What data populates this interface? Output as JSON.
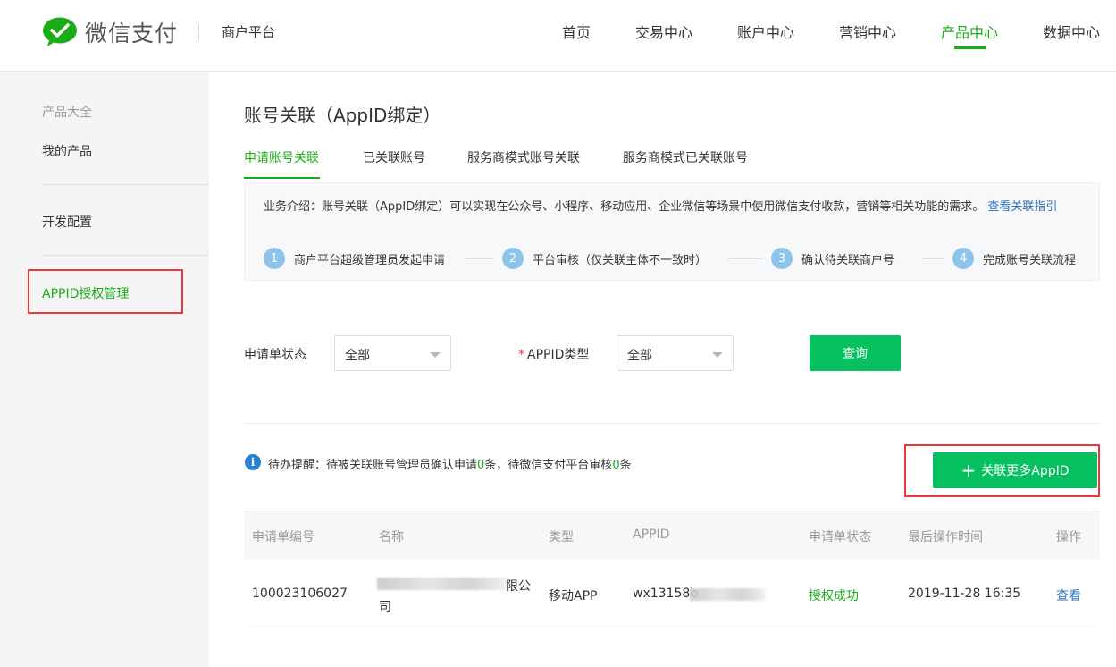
{
  "header": {
    "brand": "微信支付",
    "platform": "商户平台",
    "nav": [
      {
        "label": "首页",
        "active": false
      },
      {
        "label": "交易中心",
        "active": false
      },
      {
        "label": "账户中心",
        "active": false
      },
      {
        "label": "营销中心",
        "active": false
      },
      {
        "label": "产品中心",
        "active": true
      },
      {
        "label": "数据中心",
        "active": false
      }
    ]
  },
  "sidebar": {
    "group_title": "产品大全",
    "items": [
      "我的产品",
      "开发配置",
      "APPID授权管理"
    ],
    "active": "APPID授权管理"
  },
  "page": {
    "title": "账号关联（AppID绑定）",
    "tabs": [
      "申请账号关联",
      "已关联账号",
      "服务商模式账号关联",
      "服务商模式已关联账号"
    ],
    "active_tab": "申请账号关联"
  },
  "intro": {
    "text": "业务介绍：账号关联（AppID绑定）可以实现在公众号、小程序、移动应用、企业微信等场景中使用微信支付收款，营销等相关功能的需求。",
    "link": "查看关联指引",
    "steps": [
      {
        "num": "1",
        "label": "商户平台超级管理员发起申请"
      },
      {
        "num": "2",
        "label": "平台审核（仅关联主体不一致时）"
      },
      {
        "num": "3",
        "label": "确认待关联商户号"
      },
      {
        "num": "4",
        "label": "完成账号关联流程"
      }
    ]
  },
  "filters": {
    "status_label": "申请单状态",
    "status_value": "全部",
    "type_required": "*",
    "type_label": "APPID类型",
    "type_value": "全部",
    "query_button": "查询"
  },
  "reminder": {
    "prefix": "待办提醒：待被关联账号管理员确认申请",
    "count1": "0",
    "middle": "条，待微信支付平台审核",
    "count2": "0",
    "suffix": "条"
  },
  "add_button": "关联更多AppID",
  "table": {
    "headers": [
      "申请单编号",
      "名称",
      "类型",
      "APPID",
      "申请单状态",
      "最后操作时间",
      "操作"
    ],
    "rows": [
      {
        "id": "100023106027",
        "name_visible_end": "限公",
        "name_line2": "司",
        "type": "移动APP",
        "appid_visible": "wx13158b",
        "status": "授权成功",
        "time": "2019-11-28 16:35",
        "action": "查看"
      }
    ]
  },
  "colors": {
    "accent_green": "#1aad19",
    "button_green": "#07c160",
    "link_blue": "#2c6fb8",
    "highlight_red": "#e5393f",
    "step_blue": "#8ec3ea"
  }
}
